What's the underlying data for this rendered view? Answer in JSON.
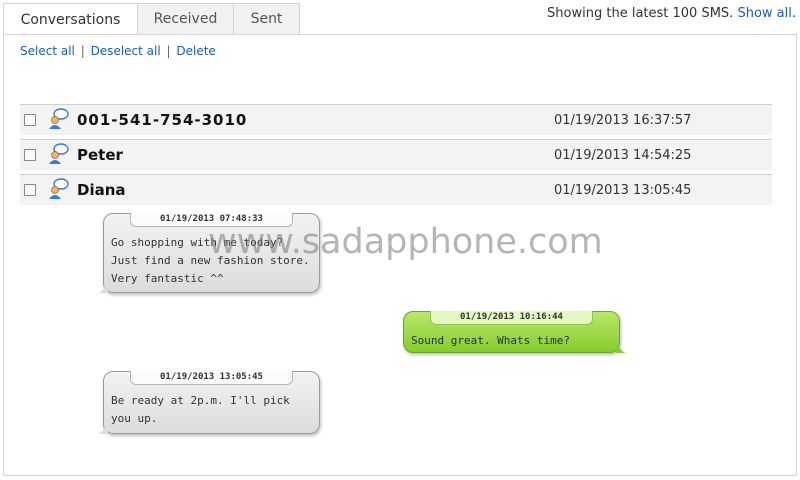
{
  "tabs": [
    {
      "label": "Conversations",
      "active": true
    },
    {
      "label": "Received",
      "active": false
    },
    {
      "label": "Sent",
      "active": false
    }
  ],
  "summary": {
    "text": "Showing the latest 100 SMS.",
    "show_all_label": "Show all",
    "trailing": "."
  },
  "actions": {
    "select_all": "Select all",
    "deselect_all": "Deselect all",
    "delete": "Delete",
    "separator": "|"
  },
  "conversations": [
    {
      "name": "001-541-754-3010",
      "timestamp": "01/19/2013 16:37:57",
      "checked": false
    },
    {
      "name": "Peter",
      "timestamp": "01/19/2013 14:54:25",
      "checked": false
    },
    {
      "name": "Diana",
      "timestamp": "01/19/2013 13:05:45",
      "checked": false
    }
  ],
  "messages": [
    {
      "direction": "received",
      "timestamp": "01/19/2013 07:48:33",
      "text": "Go shopping with me today? Just find a new fashion store. Very fantastic ^^"
    },
    {
      "direction": "sent",
      "timestamp": "01/19/2013 10:16:44",
      "text": "Sound great. Whats time?"
    },
    {
      "direction": "received",
      "timestamp": "01/19/2013 13:05:45",
      "text": "Be ready at 2p.m. I'll pick you up."
    }
  ],
  "watermark": "www.sadapphone.com",
  "icons": {
    "contact": "person-icon",
    "checkbox": "checkbox"
  },
  "colors": {
    "link": "#1a5fb4",
    "sent_bubble": "#9bd74a",
    "received_bubble": "#e6e6e6"
  }
}
